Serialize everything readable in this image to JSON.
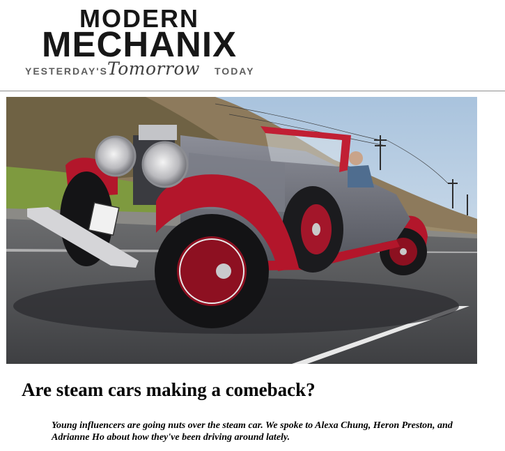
{
  "brand": {
    "line1": "MODERN",
    "line2": "MECHANIX",
    "tagline_left": "YESTERDAY'S",
    "tagline_script": "Tomorrow",
    "tagline_right": "TODAY"
  },
  "hero_image": {
    "subject": "vintage red and grey convertible car on road"
  },
  "article": {
    "headline": "Are steam cars making a comeback?",
    "dek": "Young influencers are going nuts over the steam car. We spoke to Alexa Chung, Heron Preston, and Adrianne Ho about how they've been driving around lately."
  },
  "colors": {
    "brand_text": "#171717",
    "tagline": "#5d5d5d",
    "divider": "#8f8f8f",
    "car_red": "#b3162b",
    "car_body": "#6d6f79"
  }
}
